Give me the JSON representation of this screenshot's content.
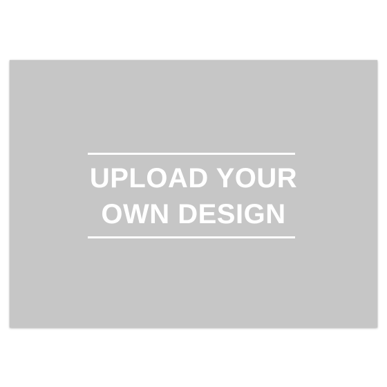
{
  "card": {
    "line1": "UPLOAD YOUR",
    "line2": "OWN DESIGN",
    "background_color": "#c6c6c6",
    "text_color": "#ffffff"
  }
}
